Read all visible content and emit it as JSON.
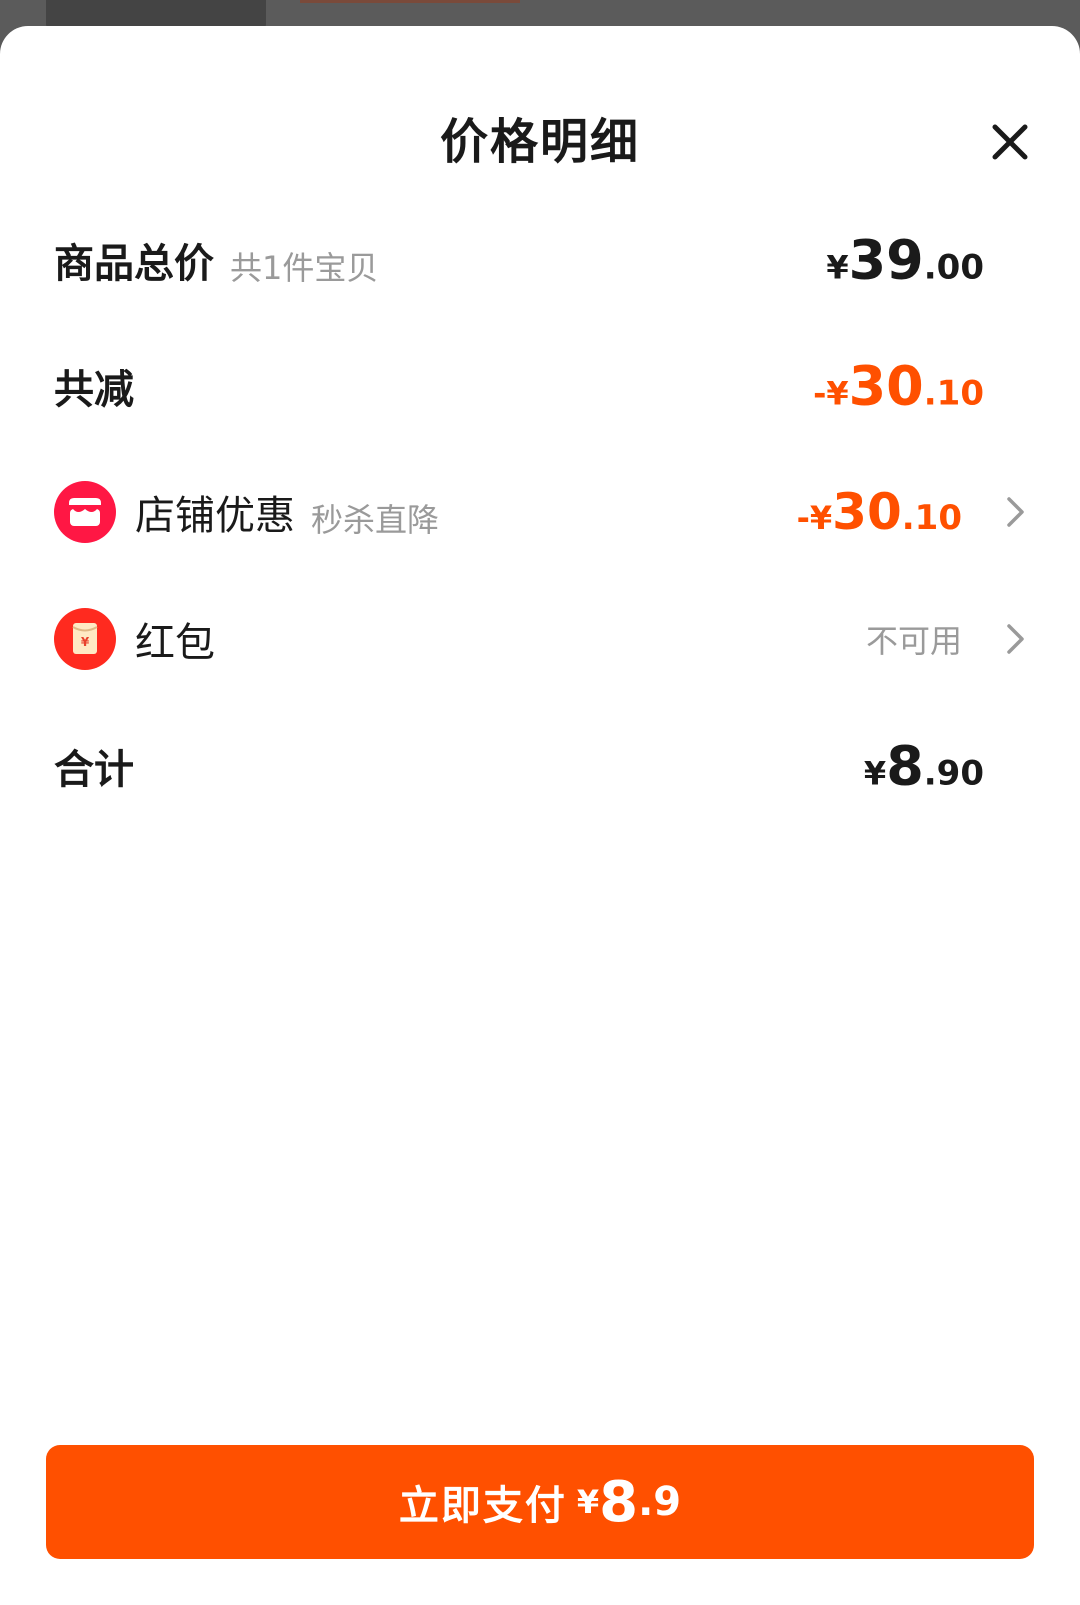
{
  "colors": {
    "accent": "#ff5000",
    "text": "#1a1a1a",
    "muted": "#9a9a9a",
    "shop_icon": "#ff1744",
    "red_packet_icon": "#ff2a1f"
  },
  "header": {
    "title": "价格明细",
    "close_icon": "close-icon"
  },
  "rows": {
    "total": {
      "label": "商品总价",
      "sub": "共1件宝贝",
      "currency": "¥",
      "int": "39",
      "dec": ".00"
    },
    "reduce": {
      "label": "共减",
      "prefix": "-",
      "currency": "¥",
      "int": "30",
      "dec": ".10"
    },
    "shop": {
      "label": "店铺优惠",
      "sub": "秒杀直降",
      "prefix": "-",
      "currency": "¥",
      "int": "30",
      "dec": ".10",
      "icon": "shop-icon"
    },
    "red_packet": {
      "label": "红包",
      "status": "不可用",
      "icon": "red-packet-icon"
    },
    "sum": {
      "label": "合计",
      "currency": "¥",
      "int": "8",
      "dec": ".90"
    }
  },
  "pay_button": {
    "label": "立即支付",
    "currency": "¥",
    "int": "8",
    "dec": ".9"
  }
}
